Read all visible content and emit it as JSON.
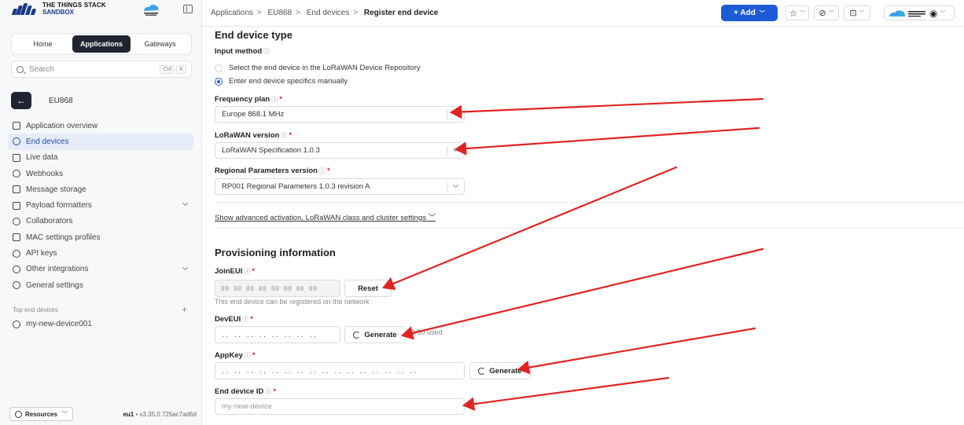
{
  "brand": {
    "line1": "THE THINGS STACK",
    "line2": "SANDBOX"
  },
  "sidebar": {
    "tabs": [
      {
        "label": "Home",
        "active": false
      },
      {
        "label": "Applications",
        "active": true
      },
      {
        "label": "Gateways",
        "active": false
      }
    ],
    "search": {
      "placeholder": "Search",
      "kbd1": "Ctrl",
      "kbd2": "K"
    },
    "app_name": "EU868",
    "nav": [
      {
        "label": "Application overview",
        "icon": "grid-icon",
        "active": false,
        "expandable": false
      },
      {
        "label": "End devices",
        "icon": "chip-icon",
        "active": true,
        "expandable": false
      },
      {
        "label": "Live data",
        "icon": "list-icon",
        "active": false,
        "expandable": false
      },
      {
        "label": "Webhooks",
        "icon": "webhook-icon",
        "active": false,
        "expandable": false
      },
      {
        "label": "Message storage",
        "icon": "database-icon",
        "active": false,
        "expandable": false
      },
      {
        "label": "Payload formatters",
        "icon": "braces-icon",
        "active": false,
        "expandable": true
      },
      {
        "label": "Collaborators",
        "icon": "users-icon",
        "active": false,
        "expandable": false
      },
      {
        "label": "MAC settings profiles",
        "icon": "box-icon",
        "active": false,
        "expandable": false
      },
      {
        "label": "API keys",
        "icon": "key-icon",
        "active": false,
        "expandable": false
      },
      {
        "label": "Other integrations",
        "icon": "integrations-icon",
        "active": false,
        "expandable": true
      },
      {
        "label": "General settings",
        "icon": "gear-icon",
        "active": false,
        "expandable": false
      }
    ],
    "top_devices_label": "Top end devices",
    "top_device": "my-new-device001",
    "resources_label": "Resources",
    "version_region": "eu1",
    "version_text": "• v3.35.0.725ac7ad6d"
  },
  "topbar": {
    "breadcrumbs": [
      "Applications",
      "EU868",
      "End devices"
    ],
    "breadcrumb_current": "Register end device",
    "add_label": "+ Add"
  },
  "form": {
    "section1_title": "End device type",
    "input_method_label": "Input method",
    "radio_repo": "Select the end device in the LoRaWAN Device Repository",
    "radio_manual": "Enter end device specifics manually",
    "freq_label": "Frequency plan",
    "freq_value": "Europe 868.1 MHz",
    "lorawan_label": "LoRaWAN version",
    "lorawan_value": "LoRaWAN Specification 1.0.3",
    "regional_label": "Regional Parameters version",
    "regional_value": "RP001 Regional Parameters 1.0.3 revision A",
    "advanced_link": "Show advanced activation, LoRaWAN class and cluster settings",
    "section2_title": "Provisioning information",
    "joineui_label": "JoinEUI",
    "joineui_value": "00 00 00 00 00 00 00 00",
    "reset_label": "Reset",
    "joineui_hint": "This end device can be registered on the network",
    "deveui_label": "DevEUI",
    "deveui_value": ".. .. .. .. .. .. .. ..",
    "generate_label": "Generate",
    "deveui_used": "2/50 used",
    "appkey_label": "AppKey",
    "appkey_value": ".. .. .. .. .. .. .. .. .. .. .. .. .. .. .. ..",
    "deviceid_label": "End device ID",
    "deviceid_placeholder": "my-new-device"
  },
  "colors": {
    "accent": "#1d5bd6",
    "annotation_arrow": "#e02424",
    "required": "#d62828"
  }
}
